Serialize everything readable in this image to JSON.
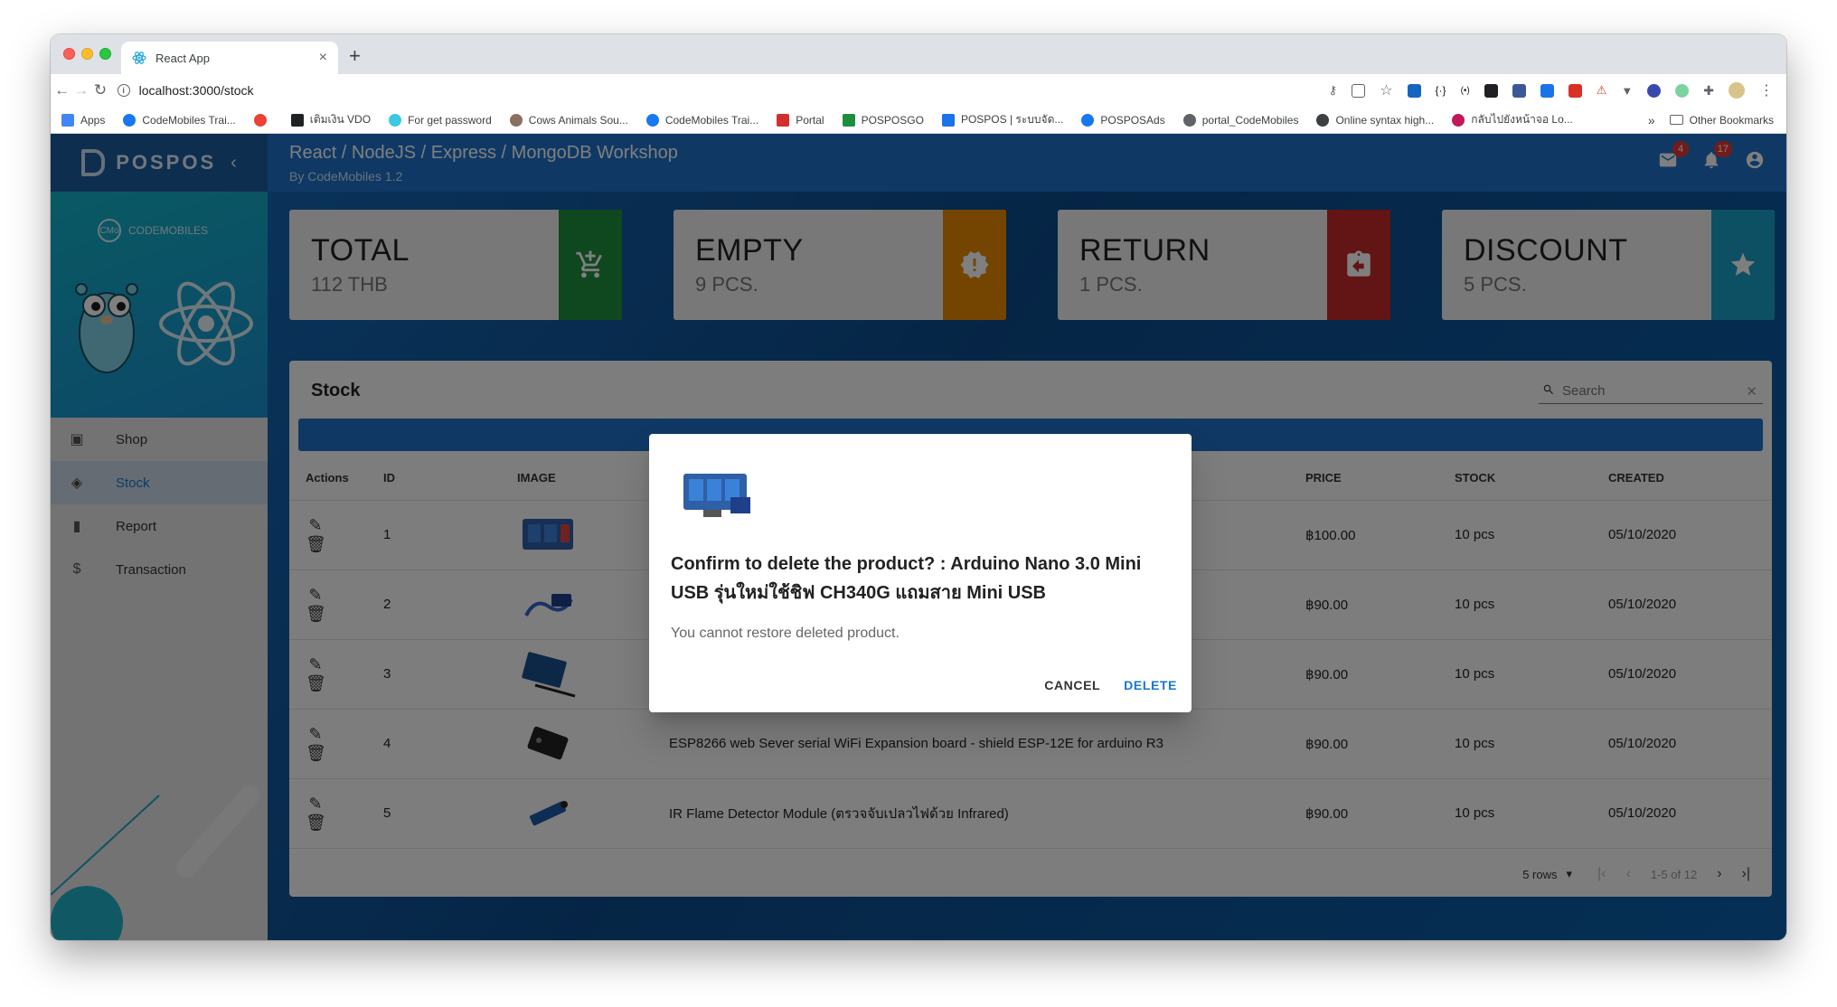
{
  "browser": {
    "tab_title": "React App",
    "tab_close": "×",
    "new_tab": "+",
    "url": "localhost:3000/stock",
    "bookmarks": [
      {
        "label": "Apps",
        "color": "#4285f4"
      },
      {
        "label": "CodeMobiles Trai...",
        "color": "#1877f2"
      },
      {
        "label": "",
        "color": "#ea4335"
      },
      {
        "label": "เติมเงิน VDO",
        "color": "#202124"
      },
      {
        "label": "For get password",
        "color": "#3cc8e0"
      },
      {
        "label": "Cows Animals Sou...",
        "color": "#8d6e63"
      },
      {
        "label": "CodeMobiles Trai...",
        "color": "#1877f2"
      },
      {
        "label": "Portal",
        "color": "#d32f2f"
      },
      {
        "label": "POSPOSGO",
        "color": "#1e8e3e"
      },
      {
        "label": "POSPOS | ระบบจัด...",
        "color": "#1a73e8"
      },
      {
        "label": "POSPOSAds",
        "color": "#1877f2"
      },
      {
        "label": "portal_CodeMobiles",
        "color": "#5f6368"
      },
      {
        "label": "Online syntax high...",
        "color": "#3c4043"
      },
      {
        "label": "กลับไปยังหน้าจอ Lo...",
        "color": "#c2185b"
      }
    ],
    "bookmarks_more": "»",
    "other_bookmarks": "Other Bookmarks"
  },
  "app": {
    "logo_text": "POSPOS",
    "title": "React / NodeJS / Express / MongoDB Workshop",
    "subtitle": "By CodeMobiles 1.2",
    "mail_badge": "4",
    "notif_badge": "17",
    "codemobiles_logo": "CODEMOBILES",
    "codemobiles_mark": "CMo"
  },
  "sidebar": {
    "items": [
      {
        "label": "Shop",
        "icon": "shop-icon",
        "active": false
      },
      {
        "label": "Stock",
        "icon": "layers-icon",
        "active": true
      },
      {
        "label": "Report",
        "icon": "bar-chart-icon",
        "active": false
      },
      {
        "label": "Transaction",
        "icon": "dollar-icon",
        "active": false
      }
    ]
  },
  "stats": [
    {
      "title": "TOTAL",
      "subtitle": "112 THB",
      "color": "#1e8e3e",
      "icon": "cart-plus-icon"
    },
    {
      "title": "EMPTY",
      "subtitle": "9 PCS.",
      "color": "#e68a00",
      "icon": "alert-badge-icon"
    },
    {
      "title": "RETURN",
      "subtitle": "1 PCS.",
      "color": "#c62828",
      "icon": "assignment-return-icon"
    },
    {
      "title": "DISCOUNT",
      "subtitle": "5 PCS.",
      "color": "#1aa0c7",
      "icon": "star-icon"
    }
  ],
  "stock": {
    "title": "Stock",
    "search_placeholder": "Search",
    "columns": {
      "actions": "Actions",
      "id": "ID",
      "image": "IMAGE",
      "name": "",
      "price": "PRICE",
      "stock": "STOCK",
      "created": "CREATED"
    },
    "rows": [
      {
        "id": "1",
        "name": "",
        "price": "฿100.00",
        "stock": "10 pcs",
        "created": "05/10/2020"
      },
      {
        "id": "2",
        "name": "",
        "price": "฿90.00",
        "stock": "10 pcs",
        "created": "05/10/2020"
      },
      {
        "id": "3",
        "name": "",
        "price": "฿90.00",
        "stock": "10 pcs",
        "created": "05/10/2020"
      },
      {
        "id": "4",
        "name": "ESP8266 web Sever serial WiFi Expansion board - shield ESP-12E for arduino R3",
        "price": "฿90.00",
        "stock": "10 pcs",
        "created": "05/10/2020"
      },
      {
        "id": "5",
        "name": "IR Flame Detector Module (ตรวจจับเปลวไฟด้วย Infrared)",
        "price": "฿90.00",
        "stock": "10 pcs",
        "created": "05/10/2020"
      }
    ],
    "pagination": {
      "rows_per_page": "5 rows",
      "range": "1-5 of 12"
    }
  },
  "dialog": {
    "title": "Confirm to delete the product? : Arduino Nano 3.0 Mini USB รุ่นใหม่ใช้ชิฟ CH340G แถมสาย Mini USB",
    "body": "You cannot restore deleted product.",
    "cancel": "CANCEL",
    "delete": "DELETE"
  },
  "colors": {
    "appbar": "#1e73c9",
    "accent": "#1976d2",
    "badge": "#e53935"
  }
}
